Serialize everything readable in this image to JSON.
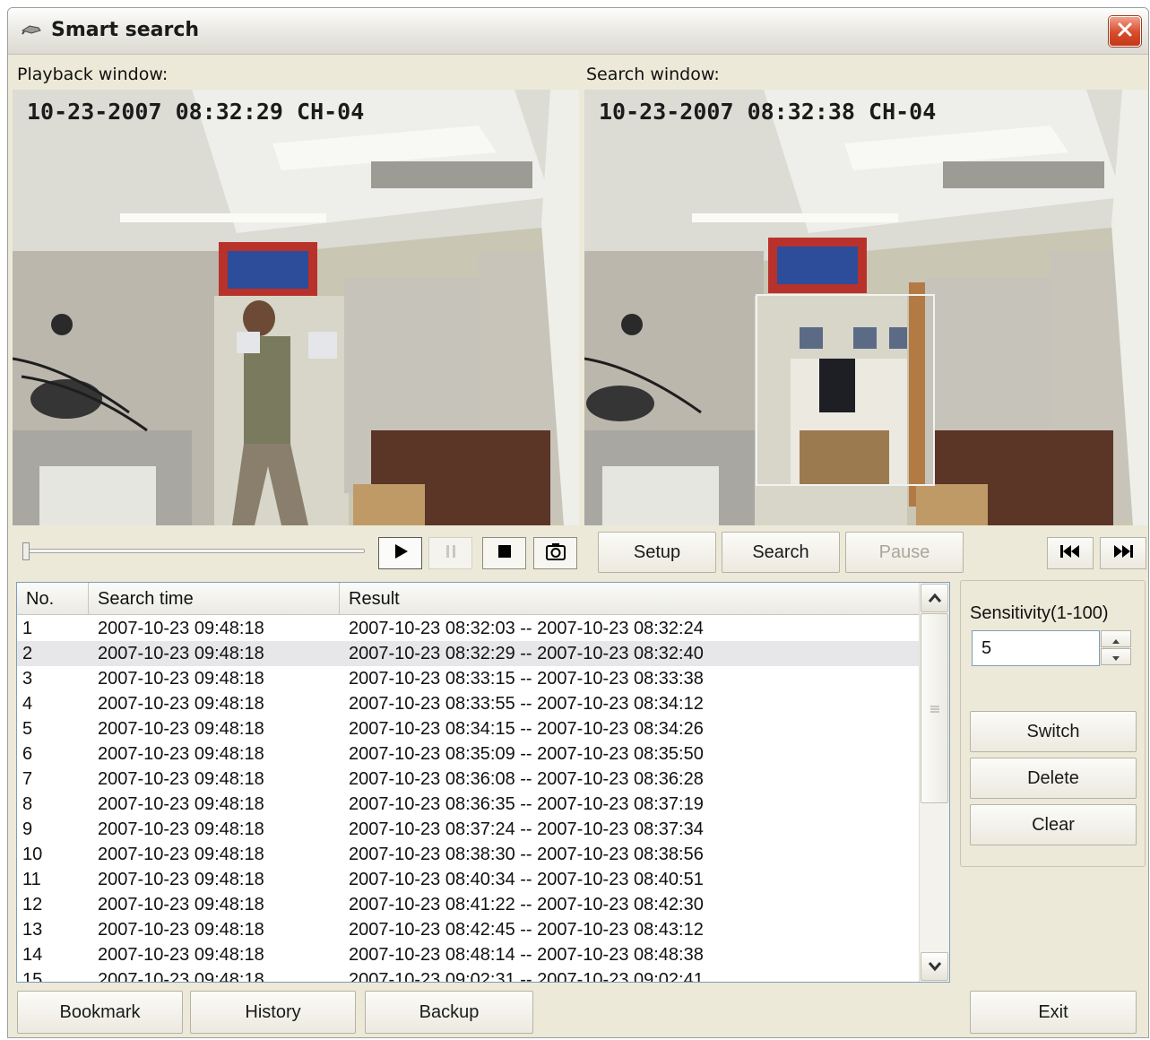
{
  "window": {
    "title": "Smart search",
    "close_icon": "close-icon"
  },
  "playback": {
    "label": "Playback window:",
    "osd": "10-23-2007 08:32:29 CH-04"
  },
  "search_view": {
    "label": "Search window:",
    "osd": "10-23-2007 08:32:38 CH-04"
  },
  "transport": {
    "icons": [
      "play-icon",
      "pause-icon",
      "stop-icon",
      "snapshot-icon"
    ],
    "nav_icons": [
      "skip-previous-icon",
      "skip-next-icon"
    ]
  },
  "actions": {
    "setup": "Setup",
    "search": "Search",
    "pause": "Pause"
  },
  "table": {
    "columns": [
      "No.",
      "Search time",
      "Result"
    ],
    "selected_row": 2,
    "rows": [
      {
        "no": "1",
        "time": "2007-10-23 09:48:18",
        "result": "2007-10-23 08:32:03 -- 2007-10-23 08:32:24"
      },
      {
        "no": "2",
        "time": "2007-10-23 09:48:18",
        "result": "2007-10-23 08:32:29 -- 2007-10-23 08:32:40"
      },
      {
        "no": "3",
        "time": "2007-10-23 09:48:18",
        "result": "2007-10-23 08:33:15 -- 2007-10-23 08:33:38"
      },
      {
        "no": "4",
        "time": "2007-10-23 09:48:18",
        "result": "2007-10-23 08:33:55 -- 2007-10-23 08:34:12"
      },
      {
        "no": "5",
        "time": "2007-10-23 09:48:18",
        "result": "2007-10-23 08:34:15 -- 2007-10-23 08:34:26"
      },
      {
        "no": "6",
        "time": "2007-10-23 09:48:18",
        "result": "2007-10-23 08:35:09 -- 2007-10-23 08:35:50"
      },
      {
        "no": "7",
        "time": "2007-10-23 09:48:18",
        "result": "2007-10-23 08:36:08 -- 2007-10-23 08:36:28"
      },
      {
        "no": "8",
        "time": "2007-10-23 09:48:18",
        "result": "2007-10-23 08:36:35 -- 2007-10-23 08:37:19"
      },
      {
        "no": "9",
        "time": "2007-10-23 09:48:18",
        "result": "2007-10-23 08:37:24 -- 2007-10-23 08:37:34"
      },
      {
        "no": "10",
        "time": "2007-10-23 09:48:18",
        "result": "2007-10-23 08:38:30 -- 2007-10-23 08:38:56"
      },
      {
        "no": "11",
        "time": "2007-10-23 09:48:18",
        "result": "2007-10-23 08:40:34 -- 2007-10-23 08:40:51"
      },
      {
        "no": "12",
        "time": "2007-10-23 09:48:18",
        "result": "2007-10-23 08:41:22 -- 2007-10-23 08:42:30"
      },
      {
        "no": "13",
        "time": "2007-10-23 09:48:18",
        "result": "2007-10-23 08:42:45 -- 2007-10-23 08:43:12"
      },
      {
        "no": "14",
        "time": "2007-10-23 09:48:18",
        "result": "2007-10-23 08:48:14 -- 2007-10-23 08:48:38"
      },
      {
        "no": "15",
        "time": "2007-10-23 09:48:18",
        "result": "2007-10-23 09:02:31 -- 2007-10-23 09:02:41"
      }
    ]
  },
  "side": {
    "sensitivity_label": "Sensitivity(1-100)",
    "sensitivity_value": "5",
    "switch": "Switch",
    "delete": "Delete",
    "clear": "Clear"
  },
  "footer": {
    "bookmark": "Bookmark",
    "history": "History",
    "backup": "Backup",
    "exit": "Exit"
  }
}
